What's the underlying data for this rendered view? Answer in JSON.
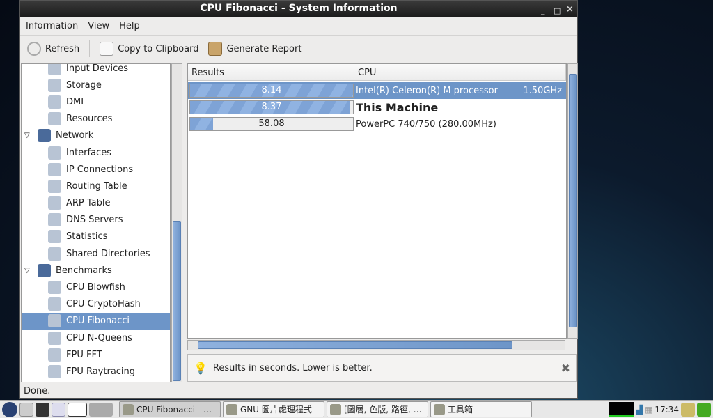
{
  "window": {
    "title": "CPU Fibonacci - System Information",
    "minimize": "_",
    "maximize": "□",
    "close": "×"
  },
  "menu": [
    "Information",
    "View",
    "Help"
  ],
  "toolbar": {
    "refresh": "Refresh",
    "copy": "Copy to Clipboard",
    "report": "Generate Report"
  },
  "tree": [
    {
      "label": "Input Devices",
      "level": 1,
      "icon": "input-devices-icon"
    },
    {
      "label": "Storage",
      "level": 1,
      "icon": "storage-icon"
    },
    {
      "label": "DMI",
      "level": 1,
      "icon": "dmi-icon"
    },
    {
      "label": "Resources",
      "level": 1,
      "icon": "resources-icon"
    },
    {
      "label": "Network",
      "level": 0,
      "icon": "network-icon"
    },
    {
      "label": "Interfaces",
      "level": 1,
      "icon": "interfaces-icon"
    },
    {
      "label": "IP Connections",
      "level": 1,
      "icon": "ip-connections-icon"
    },
    {
      "label": "Routing Table",
      "level": 1,
      "icon": "routing-table-icon"
    },
    {
      "label": "ARP Table",
      "level": 1,
      "icon": "arp-table-icon"
    },
    {
      "label": "DNS Servers",
      "level": 1,
      "icon": "dns-servers-icon"
    },
    {
      "label": "Statistics",
      "level": 1,
      "icon": "statistics-icon"
    },
    {
      "label": "Shared Directories",
      "level": 1,
      "icon": "shared-directories-icon"
    },
    {
      "label": "Benchmarks",
      "level": 0,
      "icon": "benchmarks-icon"
    },
    {
      "label": "CPU Blowfish",
      "level": 1,
      "icon": "cpu-blowfish-icon"
    },
    {
      "label": "CPU CryptoHash",
      "level": 1,
      "icon": "cpu-cryptohash-icon"
    },
    {
      "label": "CPU Fibonacci",
      "level": 1,
      "icon": "cpu-fibonacci-icon",
      "selected": true
    },
    {
      "label": "CPU N-Queens",
      "level": 1,
      "icon": "cpu-nqueens-icon"
    },
    {
      "label": "FPU FFT",
      "level": 1,
      "icon": "fpu-fft-icon"
    },
    {
      "label": "FPU Raytracing",
      "level": 1,
      "icon": "fpu-raytracing-icon"
    }
  ],
  "table": {
    "headers": [
      "Results",
      "CPU"
    ],
    "rows": [
      {
        "result": "8.14",
        "fraction": 1.0,
        "cpu": "Intel(R) Celeron(R) M processor",
        "freq": "1.50GHz",
        "selected": true
      },
      {
        "result": "8.37",
        "fraction": 0.98,
        "cpu": "This Machine",
        "freq": "",
        "bold": true
      },
      {
        "result": "58.08",
        "fraction": 0.14,
        "cpu": "PowerPC 740/750 (280.00MHz)",
        "freq": ""
      }
    ]
  },
  "info": "Results in seconds. Lower is better.",
  "status": "Done.",
  "taskbar": {
    "tasks": [
      "CPU Fibonacci - …",
      "GNU 圖片處理程式",
      "[圖層, 色版, 路徑, …",
      "工具箱"
    ],
    "clock": "17:34"
  },
  "colors": {
    "accent": "#6d95c8"
  }
}
